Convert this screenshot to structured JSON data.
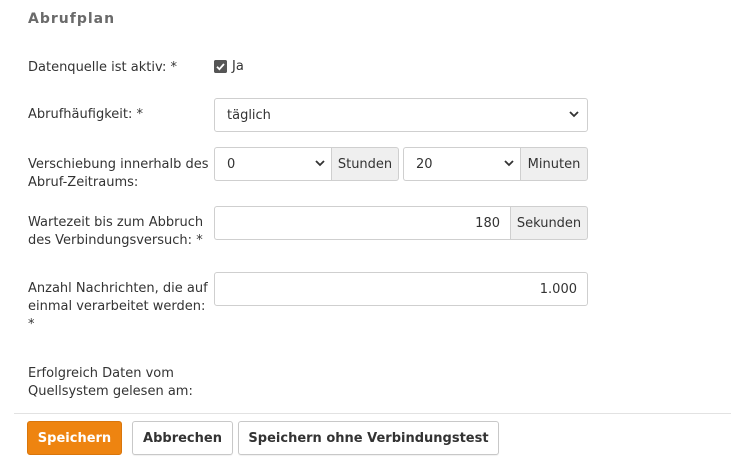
{
  "section": {
    "title": "Abrufplan"
  },
  "active": {
    "label": "Datenquelle ist aktiv: *",
    "checkbox_label": "Ja",
    "checked": true
  },
  "frequency": {
    "label": "Abrufhäufigkeit: *",
    "value": "täglich"
  },
  "shift": {
    "label": "Verschiebung innerhalb des Abruf-Zeitraums:",
    "hours_value": "0",
    "hours_unit": "Stunden",
    "minutes_value": "20",
    "minutes_unit": "Minuten"
  },
  "timeout": {
    "label": "Wartezeit bis zum Abbruch des Verbindungsversuch: *",
    "value": "180",
    "unit": "Sekunden"
  },
  "messages": {
    "label": "Anzahl Nachrichten, die auf einmal verarbeitet werden: *",
    "value": "1.000"
  },
  "last_read": {
    "label": "Erfolgreich Daten vom Quellsystem gelesen am:",
    "value": ""
  },
  "actions": {
    "save": "Speichern",
    "cancel": "Abbrechen",
    "save_no_test": "Speichern ohne Verbindungstest"
  },
  "colors": {
    "primary": "#ee8410",
    "addon_bg": "#efefef",
    "border": "#cfcfcf"
  },
  "icons": {
    "checkbox": "check-icon",
    "select_arrow": "chevron-down-icon"
  }
}
